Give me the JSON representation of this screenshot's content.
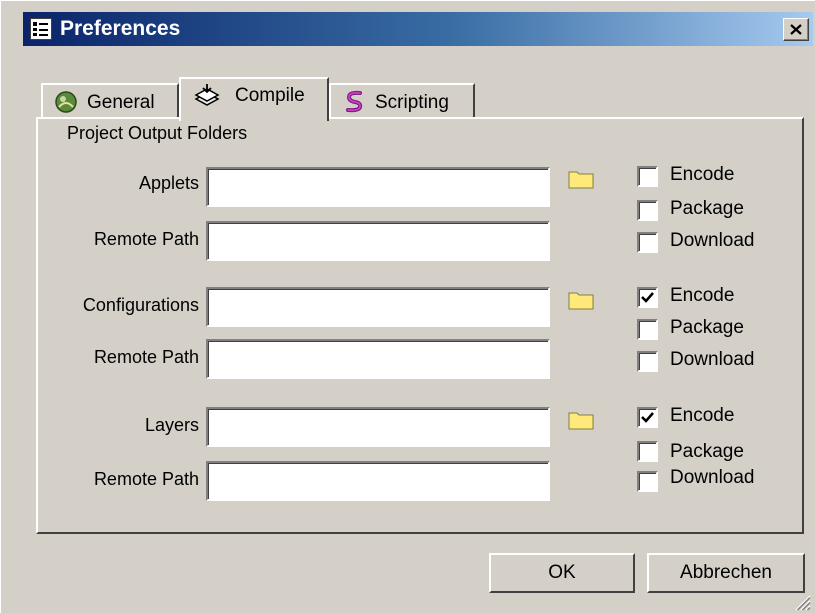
{
  "window": {
    "title": "Preferences"
  },
  "tabs": [
    {
      "label": "General",
      "icon": "general-icon",
      "selected": false
    },
    {
      "label": "Compile",
      "icon": "compile-icon",
      "selected": true
    },
    {
      "label": "Scripting",
      "icon": "scripting-icon",
      "selected": false
    }
  ],
  "compile": {
    "section_title": "Project Output Folders",
    "groups": [
      {
        "label": "Applets",
        "value": "",
        "remote_label": "Remote Path",
        "remote_value": "",
        "options": [
          {
            "label": "Encode",
            "checked": false
          },
          {
            "label": "Package",
            "checked": false
          },
          {
            "label": "Download",
            "checked": false
          }
        ]
      },
      {
        "label": "Configurations",
        "value": "",
        "remote_label": "Remote Path",
        "remote_value": "",
        "options": [
          {
            "label": "Encode",
            "checked": true
          },
          {
            "label": "Package",
            "checked": false
          },
          {
            "label": "Download",
            "checked": false
          }
        ]
      },
      {
        "label": "Layers",
        "value": "",
        "remote_label": "Remote Path",
        "remote_value": "",
        "options": [
          {
            "label": "Encode",
            "checked": true
          },
          {
            "label": "Package",
            "checked": false
          },
          {
            "label": "Download",
            "checked": false
          }
        ]
      }
    ]
  },
  "buttons": {
    "ok": "OK",
    "cancel": "Abbrechen"
  },
  "colors": {
    "window_bg": "#d4d0c8",
    "titlebar_start": "#0a246a",
    "titlebar_end": "#a6caf0",
    "folder_yellow": "#ffe97a"
  }
}
